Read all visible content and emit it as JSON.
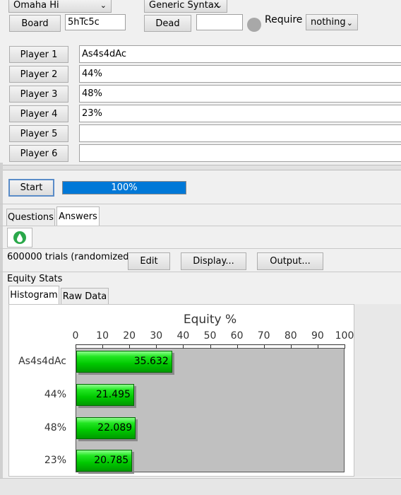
{
  "top": {
    "game_select": "Omaha Hi",
    "syntax_select": "Generic Syntax",
    "board_button": "Board",
    "board_value": "5hTc5c",
    "dead_button": "Dead",
    "dead_value": "",
    "require_label": "Require",
    "require_select": "nothing"
  },
  "players": [
    {
      "label": "Player 1",
      "value": "As4s4dAc"
    },
    {
      "label": "Player 2",
      "value": "44%"
    },
    {
      "label": "Player 3",
      "value": "48%"
    },
    {
      "label": "Player 4",
      "value": "23%"
    },
    {
      "label": "Player 5",
      "value": ""
    },
    {
      "label": "Player 6",
      "value": ""
    }
  ],
  "run": {
    "start_button": "Start",
    "progress_text": "100%",
    "progress": 1.0
  },
  "tabs": {
    "questions": "Questions",
    "answers": "Answers"
  },
  "results": {
    "trials_text": "600000 trials (randomized)",
    "edit_button": "Edit",
    "display_button": "Display...",
    "output_button": "Output...",
    "section_title": "Equity Stats",
    "histogram_tab": "Histogram",
    "raw_tab": "Raw Data"
  },
  "colors": {
    "bar": "#00c800",
    "plot_bg": "#c0c0c0",
    "progress": "#0078d7"
  },
  "chart_data": {
    "type": "bar",
    "orientation": "horizontal",
    "title": "Equity %",
    "categories": [
      "As4s4dAc",
      "44%",
      "48%",
      "23%"
    ],
    "values": [
      35.632,
      21.495,
      22.089,
      20.785
    ],
    "value_labels": [
      "35.632",
      "21.495",
      "22.089",
      "20.785"
    ],
    "xlim": [
      0,
      100
    ],
    "ticks": [
      "0",
      "10",
      "20",
      "30",
      "40",
      "50",
      "60",
      "70",
      "80",
      "90",
      "100"
    ],
    "grid": false,
    "legend": "none"
  }
}
